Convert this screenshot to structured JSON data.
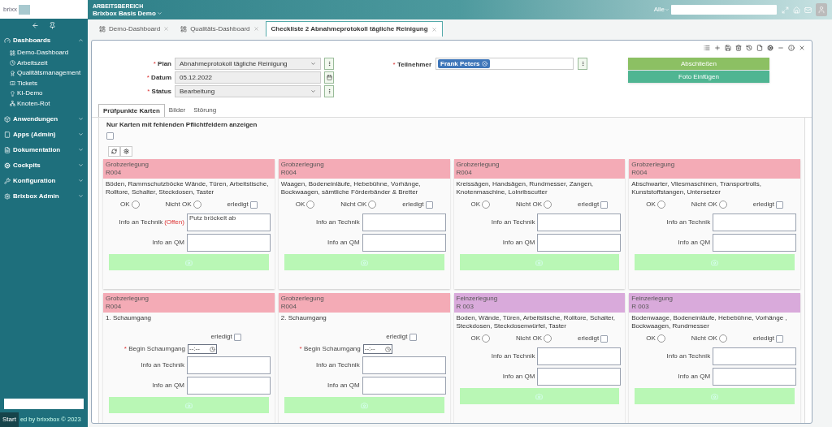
{
  "logo": {
    "text": "brixx"
  },
  "sidebar": {
    "items": [
      {
        "label": "Dashboards",
        "expanded": true,
        "children": [
          {
            "label": "Demo-Dashboard"
          },
          {
            "label": "Arbeitszeit"
          },
          {
            "label": "Qualitätsmanagement"
          },
          {
            "label": "Tickets"
          },
          {
            "label": "KI-Demo"
          },
          {
            "label": "Knoten-Rot"
          }
        ]
      },
      {
        "label": "Anwendungen",
        "expanded": false
      },
      {
        "label": "Apps (Admin)",
        "expanded": false
      },
      {
        "label": "Dokumentation",
        "expanded": false
      },
      {
        "label": "Cockpits",
        "expanded": false
      },
      {
        "label": "Konfiguration",
        "expanded": false
      },
      {
        "label": "Brixbox Admin",
        "expanded": false
      }
    ],
    "footer": "ed by brixxbox © 2023",
    "start_button": "Start"
  },
  "topbar": {
    "workspace_label": "ARBEITSBEREICH",
    "workspace": "Brixbox Basis Demo",
    "filter": "Alle"
  },
  "tabs": [
    {
      "label": "Demo-Dashboard",
      "selected": false
    },
    {
      "label": "Qualitäts-Dashboard",
      "selected": false
    },
    {
      "label": "Checkliste 2 Abnahmeprotokoll tägliche Reinigung",
      "selected": true
    }
  ],
  "form": {
    "fields": [
      {
        "kind": "select",
        "marker": "*",
        "label": "Plan",
        "value": "Abnahmeprotokoll tägliche Reinigung"
      },
      {
        "kind": "date",
        "marker": "*",
        "label": "Datum",
        "value": "05.12.2022"
      },
      {
        "kind": "select",
        "marker": "*",
        "label": "Status",
        "value": "Bearbeitung"
      }
    ],
    "teilnehmer": {
      "marker": "*",
      "label": "Teilnehmer",
      "values": [
        "Frank Peters"
      ]
    }
  },
  "actions": [
    "Abschließen",
    "Foto Einfügen"
  ],
  "inner_tabs": [
    {
      "label": "Prüfpunkte Karten",
      "selected": true
    },
    {
      "label": "Bilder",
      "selected": false
    },
    {
      "label": "Störung",
      "selected": false
    }
  ],
  "filter": {
    "label": "Nur Karten mit fehlenden Pflichtfeldern anzeigen",
    "checked": false
  },
  "cards": [
    {
      "kind": "check",
      "color": "#f4abb6",
      "category": "Grobzerlegung",
      "room": "R004",
      "description": "Böden, Rammschutzböcke Wände, Türen, Arbeitstische, Rolltore, Schalter, Steckdosen, Taster",
      "options": [
        {
          "label": "OK",
          "selected": false
        },
        {
          "label": "Nicht OK",
          "selected": false
        }
      ],
      "done": {
        "label": "erledigt",
        "checked": false
      },
      "technik_label": "Info an Technik",
      "technik_status": "(Offen)",
      "technik_value": "Putz bröckelt ab",
      "qm_label": "Info an QM"
    },
    {
      "kind": "check",
      "color": "#f4abb6",
      "category": "Grobzerlegung",
      "room": "R004",
      "description": "Waagen, Bodeneinläufe, Hebebühne, Vorhänge, Bockwaagen, sämtliche Förderbänder & Bretter",
      "options": [
        {
          "label": "OK",
          "selected": false
        },
        {
          "label": "Nicht OK",
          "selected": false
        }
      ],
      "done": {
        "label": "erledigt",
        "checked": false
      },
      "technik_label": "Info an Technik",
      "qm_label": "Info an QM"
    },
    {
      "kind": "check",
      "color": "#f4abb6",
      "category": "Grobzerlegung",
      "room": "R004",
      "description": "Kreissägen, Handsägen, Rundmesser, Zangen, Knotenmaschine, Lolnribscutter",
      "options": [
        {
          "label": "OK",
          "selected": false
        },
        {
          "label": "Nicht OK",
          "selected": false
        }
      ],
      "done": {
        "label": "erledigt",
        "checked": false
      },
      "technik_label": "Info an Technik",
      "qm_label": "Info an QM"
    },
    {
      "kind": "check",
      "color": "#f4abb6",
      "category": "Grobzerlegung",
      "room": "R004",
      "description": "Abschwarter, Vliesmaschinen, Transportrolls, Kunststoffstangen, Untersetzer",
      "options": [
        {
          "label": "OK",
          "selected": false
        },
        {
          "label": "Nicht OK",
          "selected": false
        }
      ],
      "done": {
        "label": "erledigt",
        "checked": false
      },
      "technik_label": "Info an Technik",
      "qm_label": "Info an QM"
    },
    {
      "kind": "time",
      "color": "#f4abb6",
      "category": "Grobzerlegung",
      "room": "R004",
      "description": "1. Schaumgang",
      "done": {
        "label": "erledigt",
        "checked": false
      },
      "time_marker": "*",
      "time_label": "Begin Schaumgang",
      "time_placeholder": "--:--",
      "technik_label": "Info an Technik",
      "qm_label": "Info an QM"
    },
    {
      "kind": "time",
      "color": "#f4abb6",
      "category": "Grobzerlegung",
      "room": "R004",
      "description": "2. Schaumgang",
      "done": {
        "label": "erledigt",
        "checked": false
      },
      "time_marker": "*",
      "time_label": "Begin Schaumgang",
      "time_placeholder": "--:--",
      "technik_label": "Info an Technik",
      "qm_label": "Info an QM"
    },
    {
      "kind": "check",
      "color": "#d9aadb",
      "category": "Feinzerlegung",
      "room": "R 003",
      "description": "Boden, Wände, Türen, Arbeitstische, Rolltore, Schalter, Steckdosen, Steckdosenwürfel, Taster",
      "options": [
        {
          "label": "OK",
          "selected": false
        },
        {
          "label": "Nicht OK",
          "selected": false
        }
      ],
      "done": {
        "label": "erledigt",
        "checked": false
      },
      "technik_label": "Info an Technik",
      "qm_label": "Info an QM"
    },
    {
      "kind": "check",
      "color": "#d9aadb",
      "category": "Feinzerlegung",
      "room": "R 003",
      "description": "Bodenwaage, Bodeneinläufe, Hebebühne, Vorhänge , Bockwaagen, Rundmesser",
      "options": [
        {
          "label": "OK",
          "selected": false
        },
        {
          "label": "Nicht OK",
          "selected": false
        }
      ],
      "done": {
        "label": "erledigt",
        "checked": false
      },
      "technik_label": "Info an Technik",
      "qm_label": "Info an QM"
    }
  ]
}
